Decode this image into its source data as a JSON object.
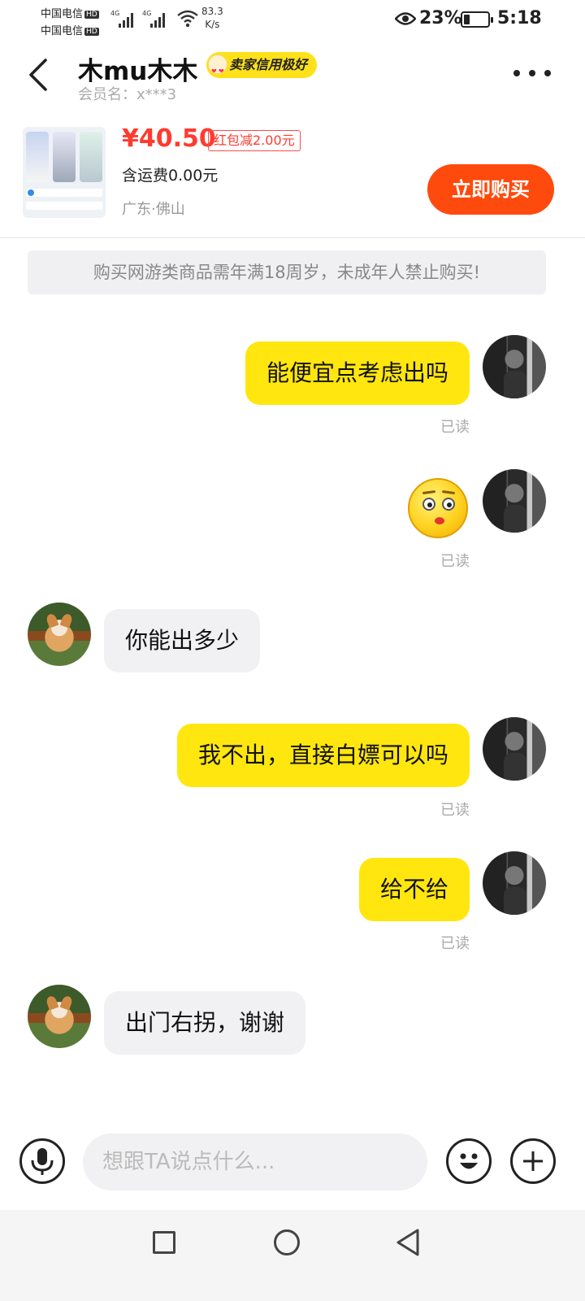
{
  "status_bar": {
    "carrier_1": "中国电信",
    "carrier_2": "中国电信",
    "hd_label": "HD",
    "network_1": "4G",
    "network_2": "4G",
    "speed_value": "83.3",
    "speed_unit": "K/s",
    "battery_percent": "23%",
    "time": "5:18"
  },
  "header": {
    "seller_name": "木mu木木",
    "credit_badge": "卖家信用极好",
    "member_label": "会员名：x***3"
  },
  "product": {
    "price": "¥40.50",
    "coupon": "红包减2.00元",
    "shipping": "含运费0.00元",
    "location": "广东·佛山",
    "buy_label": "立即购买"
  },
  "notice": "购买网游类商品需年满18周岁，未成年人禁止购买!",
  "messages": [
    {
      "from": "me",
      "text": "能便宜点考虑出吗",
      "status": "已读"
    },
    {
      "from": "me",
      "emoji": "flushed-face",
      "status": "已读"
    },
    {
      "from": "them",
      "text": "你能出多少"
    },
    {
      "from": "me",
      "text": "我不出，直接白嫖可以吗",
      "status": "已读"
    },
    {
      "from": "me",
      "text": "给不给",
      "status": "已读"
    },
    {
      "from": "them",
      "text": "出门右拐，谢谢"
    }
  ],
  "input": {
    "placeholder": "想跟TA说点什么..."
  },
  "colors": {
    "accent_yellow": "#ffe60f",
    "buy_orange": "#ff4a0d",
    "price_red": "#ff3b30"
  }
}
